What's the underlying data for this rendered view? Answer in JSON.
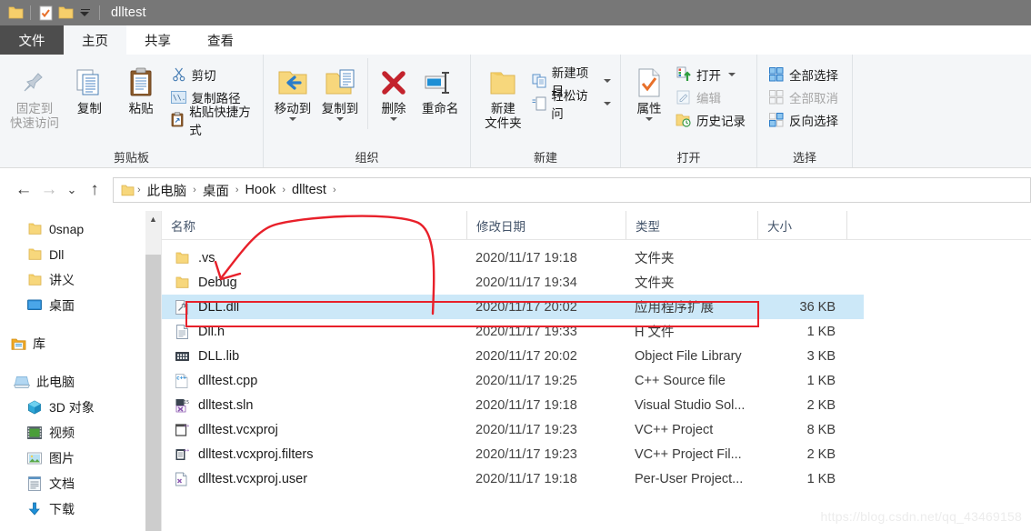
{
  "window": {
    "title": "dlltest",
    "quick_access": [
      {
        "name": "folder-icon",
        "label": ""
      },
      {
        "name": "properties-icon",
        "label": ""
      },
      {
        "name": "new-folder-icon",
        "label": ""
      },
      {
        "name": "customize-quick-access-chevron-icon",
        "label": ""
      }
    ]
  },
  "tabs": {
    "file": "文件",
    "items": [
      {
        "label": "主页",
        "active": true
      },
      {
        "label": "共享",
        "active": false
      },
      {
        "label": "查看",
        "active": false
      }
    ]
  },
  "ribbon": {
    "groups": [
      {
        "label": "剪贴板",
        "big": [
          {
            "label1": "固定到",
            "label2": "快速访问",
            "icon": "pin-icon",
            "dim": true
          },
          {
            "label1": "复制",
            "label2": "",
            "icon": "copy-icon",
            "dim": false
          },
          {
            "label1": "粘贴",
            "label2": "",
            "icon": "paste-icon",
            "dim": false
          }
        ],
        "small": [
          {
            "label": "剪切",
            "icon": "scissors-icon"
          },
          {
            "label": "复制路径",
            "icon": "copy-path-icon"
          },
          {
            "label": "粘贴快捷方式",
            "icon": "paste-shortcut-icon"
          }
        ]
      },
      {
        "label": "组织",
        "big": [
          {
            "label1": "移动到",
            "label2": "",
            "icon": "move-to-icon",
            "caret": true
          },
          {
            "label1": "复制到",
            "label2": "",
            "icon": "copy-to-icon",
            "caret": true
          },
          {
            "label1": "删除",
            "label2": "",
            "icon": "delete-icon",
            "caret": true
          },
          {
            "label1": "重命名",
            "label2": "",
            "icon": "rename-icon",
            "caret": false
          }
        ],
        "small": []
      },
      {
        "label": "新建",
        "big": [
          {
            "label1": "新建",
            "label2": "文件夹",
            "icon": "new-folder-icon",
            "caret": false
          }
        ],
        "small": [
          {
            "label": "新建项目",
            "icon": "new-item-icon",
            "caret": true
          },
          {
            "label": "轻松访问",
            "icon": "easy-access-icon",
            "caret": true
          }
        ]
      },
      {
        "label": "打开",
        "big": [
          {
            "label1": "属性",
            "label2": "",
            "icon": "properties-icon",
            "caret": true
          }
        ],
        "small": [
          {
            "label": "打开",
            "icon": "open-icon",
            "caret": true
          },
          {
            "label": "编辑",
            "icon": "edit-icon",
            "dim": true
          },
          {
            "label": "历史记录",
            "icon": "history-icon"
          }
        ]
      },
      {
        "label": "选择",
        "big": [],
        "small": [
          {
            "label": "全部选择",
            "icon": "select-all-icon"
          },
          {
            "label": "全部取消",
            "icon": "select-none-icon",
            "dim": true
          },
          {
            "label": "反向选择",
            "icon": "invert-selection-icon"
          }
        ]
      }
    ]
  },
  "address": {
    "back": "←",
    "forward": "→",
    "recent": "⌄",
    "up": "↑",
    "crumbs": [
      "此电脑",
      "桌面",
      "Hook",
      "dlltest"
    ],
    "separator": "›"
  },
  "sidebar": {
    "items": [
      {
        "label": "0snap",
        "icon": "folder-icon",
        "indent": 28
      },
      {
        "label": "Dll",
        "icon": "folder-icon",
        "indent": 28
      },
      {
        "label": "讲义",
        "icon": "folder-icon",
        "indent": 28
      },
      {
        "label": "桌面",
        "icon": "desktop-icon",
        "indent": 28
      },
      {
        "label": "",
        "icon": "spacer",
        "indent": 0
      },
      {
        "label": "库",
        "icon": "library-icon",
        "indent": 14
      },
      {
        "label": "",
        "icon": "spacer",
        "indent": 0
      },
      {
        "label": "此电脑",
        "icon": "this-pc-icon",
        "indent": 14
      },
      {
        "label": "3D 对象",
        "icon": "3d-objects-icon",
        "indent": 28
      },
      {
        "label": "视频",
        "icon": "videos-icon",
        "indent": 28
      },
      {
        "label": "图片",
        "icon": "pictures-icon",
        "indent": 28
      },
      {
        "label": "文档",
        "icon": "documents-icon",
        "indent": 28
      },
      {
        "label": "下载",
        "icon": "downloads-icon",
        "indent": 28
      }
    ]
  },
  "filelist": {
    "columns": [
      "名称",
      "修改日期",
      "类型",
      "大小"
    ],
    "rows": [
      {
        "name": ".vs",
        "date": "2020/11/17 19:18",
        "type": "文件夹",
        "size": "",
        "icon": "folder-icon",
        "selected": false
      },
      {
        "name": "Debug",
        "date": "2020/11/17 19:34",
        "type": "文件夹",
        "size": "",
        "icon": "folder-icon",
        "selected": false
      },
      {
        "name": "DLL.dll",
        "date": "2020/11/17 20:02",
        "type": "应用程序扩展",
        "size": "36 KB",
        "icon": "dll-file-icon",
        "selected": true
      },
      {
        "name": "Dll.h",
        "date": "2020/11/17 19:33",
        "type": "H 文件",
        "size": "1 KB",
        "icon": "header-file-icon",
        "selected": false
      },
      {
        "name": "DLL.lib",
        "date": "2020/11/17 20:02",
        "type": "Object File Library",
        "size": "3 KB",
        "icon": "lib-file-icon",
        "selected": false
      },
      {
        "name": "dlltest.cpp",
        "date": "2020/11/17 19:25",
        "type": "C++ Source file",
        "size": "1 KB",
        "icon": "cpp-file-icon",
        "selected": false
      },
      {
        "name": "dlltest.sln",
        "date": "2020/11/17 19:18",
        "type": "Visual Studio Sol...",
        "size": "2 KB",
        "icon": "sln-file-icon",
        "selected": false
      },
      {
        "name": "dlltest.vcxproj",
        "date": "2020/11/17 19:23",
        "type": "VC++ Project",
        "size": "8 KB",
        "icon": "vcxproj-file-icon",
        "selected": false
      },
      {
        "name": "dlltest.vcxproj.filters",
        "date": "2020/11/17 19:23",
        "type": "VC++ Project Fil...",
        "size": "2 KB",
        "icon": "filters-file-icon",
        "selected": false
      },
      {
        "name": "dlltest.vcxproj.user",
        "date": "2020/11/17 19:18",
        "type": "Per-User Project...",
        "size": "1 KB",
        "icon": "user-file-icon",
        "selected": false
      }
    ]
  },
  "annotations": {
    "color": "#e8202a",
    "highlight_box": "DLL.dll",
    "arrow_target": "Debug"
  },
  "watermark": "https://blog.csdn.net/qq_43469158",
  "colors": {
    "titlebar": "#777777",
    "file_tab": "#4d4d4d",
    "ribbon_bg": "#f4f6f8",
    "selection": "#cce8f8",
    "annotation": "#e8202a",
    "folder": "#fbd36b"
  }
}
